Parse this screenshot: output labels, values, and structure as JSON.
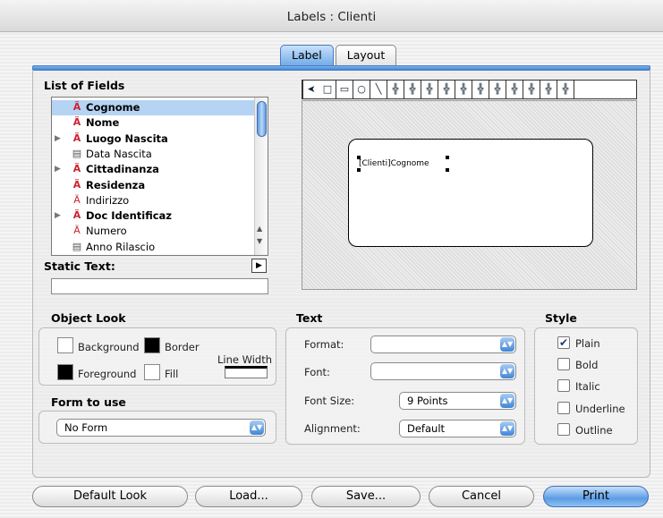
{
  "window": {
    "title": "Labels : Clienti"
  },
  "tabs": [
    {
      "label": "Label"
    },
    {
      "label": "Layout"
    }
  ],
  "list_of_fields": {
    "title": "List of Fields",
    "items": [
      {
        "label": "Cognome",
        "icon": "alpha-field-icon",
        "selected": true,
        "bold": true,
        "expandable": false
      },
      {
        "label": "Nome",
        "icon": "alpha-field-icon",
        "bold": true,
        "expandable": false
      },
      {
        "label": "Luogo Nascita",
        "icon": "alpha-field-icon",
        "bold": true,
        "expandable": true
      },
      {
        "label": "Data Nascita",
        "icon": "date-field-icon",
        "bold": false,
        "expandable": false
      },
      {
        "label": "Cittadinanza",
        "icon": "alpha-field-icon",
        "bold": true,
        "expandable": true
      },
      {
        "label": "Residenza",
        "icon": "alpha-field-icon",
        "bold": true,
        "expandable": false
      },
      {
        "label": "Indirizzo",
        "icon": "alpha-field-icon",
        "bold": false,
        "expandable": false
      },
      {
        "label": "Doc Identificaz",
        "icon": "alpha-field-icon",
        "bold": true,
        "expandable": true
      },
      {
        "label": "Numero",
        "icon": "alpha-field-icon",
        "bold": false,
        "expandable": false
      },
      {
        "label": "Anno Rilascio",
        "icon": "date-field-icon",
        "bold": false,
        "expandable": false
      }
    ]
  },
  "static_text": {
    "title": "Static Text:",
    "value": ""
  },
  "canvas": {
    "label_field": "[Clienti]Cognome"
  },
  "toolbar": [
    "arrow-tool-icon",
    "rectangle-tool-icon",
    "rounded-rect-tool-icon",
    "oval-tool-icon",
    "line-tool-icon",
    "align-left-icon",
    "align-center-h-icon",
    "align-bottom-icon",
    "align-top-icon",
    "align-center-v-icon",
    "align-right-icon",
    "distribute-h-icon",
    "distribute-v-icon",
    "front-icon",
    "back-icon",
    "group-icon"
  ],
  "object_look": {
    "title": "Object Look",
    "background": "Background",
    "border": "Border",
    "foreground": "Foreground",
    "fill": "Fill",
    "line_width": "Line Width"
  },
  "form_to_use": {
    "title": "Form to use",
    "value": "No Form"
  },
  "text": {
    "title": "Text",
    "format_label": "Format:",
    "format_value": "",
    "font_label": "Font:",
    "font_value": "",
    "size_label": "Font Size:",
    "size_value": "9 Points",
    "align_label": "Alignment:",
    "align_value": "Default"
  },
  "style": {
    "title": "Style",
    "plain": "Plain",
    "bold": "Bold",
    "italic": "Italic",
    "underline": "Underline",
    "outline": "Outline"
  },
  "buttons": {
    "default_look": "Default Look",
    "load": "Load...",
    "save": "Save...",
    "cancel": "Cancel",
    "print": "Print"
  },
  "colors": {
    "accent": "#3d86d6",
    "selection": "#b5d3f3"
  }
}
